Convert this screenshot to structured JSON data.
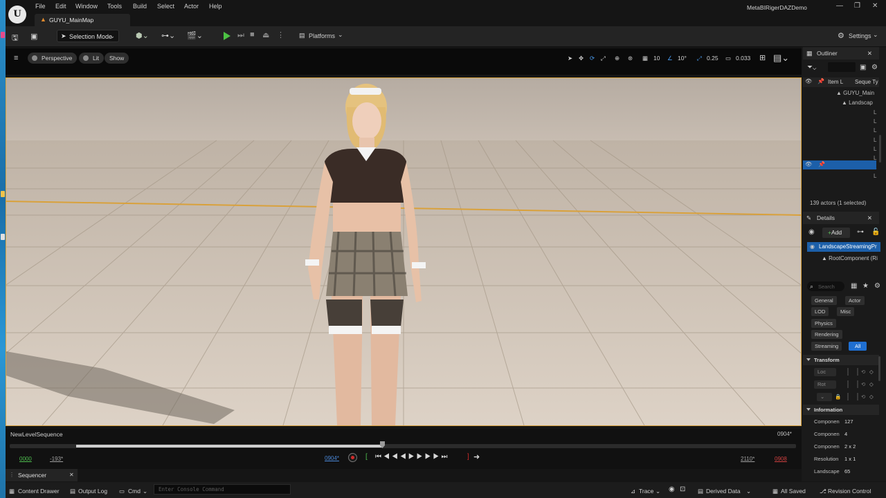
{
  "window": {
    "project_title": "MetaBIRigerDAZDemo",
    "controls": [
      "—",
      "❐",
      "✕"
    ]
  },
  "menu": [
    "File",
    "Edit",
    "Window",
    "Tools",
    "Build",
    "Select",
    "Actor",
    "Help"
  ],
  "map_tab": {
    "label": "GUYU_MainMap"
  },
  "toolbar": {
    "selection_mode": "Selection Mode",
    "platforms": "Platforms",
    "settings": "Settings"
  },
  "viewport": {
    "perspective": "Perspective",
    "lit": "Lit",
    "show": "Show",
    "grid_snap": "10",
    "rotation_snap": "10°",
    "scale_snap": "0.25",
    "camera_speed": "0.033"
  },
  "outliner": {
    "title": "Outliner",
    "col_item": "Item L",
    "col_seq": "Seque  Ty",
    "items": [
      "GUYU_Main",
      "Landscap"
    ],
    "tail_letters": [
      "L",
      "L",
      "L",
      "L",
      "L",
      "L",
      "L",
      "L",
      "L",
      "L",
      "L"
    ],
    "status": "139 actors (1 selected)"
  },
  "details": {
    "title": "Details",
    "add": "Add",
    "actor_name": "LandscapeStreamingPr",
    "root_component": "RootComponent (Ri",
    "search_placeholder": "Search",
    "categories": [
      "General",
      "Actor",
      "LOD",
      "Misc",
      "Physics",
      "Rendering",
      "Streaming",
      "All"
    ],
    "transform_label": "Transform",
    "transform_rows": [
      "Loc",
      "Rot",
      ""
    ],
    "information_label": "Information",
    "info_rows": [
      {
        "label": "Componen",
        "value": "127"
      },
      {
        "label": "Componen",
        "value": "4"
      },
      {
        "label": "Componen",
        "value": "2 x 2"
      },
      {
        "label": "Resolution",
        "value": "1 x 1"
      },
      {
        "label": "Landscape",
        "value": "65"
      }
    ]
  },
  "sequencer": {
    "name": "NewLevelSequence",
    "current_frame_right": "0904*",
    "start": "0000",
    "view_start": "-193*",
    "current_frame": "0904*",
    "view_end": "2110*",
    "end": "0908",
    "tab": "Sequencer"
  },
  "statusbar": {
    "content_drawer": "Content Drawer",
    "output_log": "Output Log",
    "cmd": "Cmd",
    "console_placeholder": "Enter Console Command",
    "trace": "Trace",
    "derived_data": "Derived Data",
    "all_saved": "All Saved",
    "revision_control": "Revision Control"
  },
  "colors": {
    "accent_blue": "#1f6fd1",
    "play_green": "#4cc243",
    "viewport_border": "#d9a13b",
    "record_red": "#d02a2a"
  }
}
